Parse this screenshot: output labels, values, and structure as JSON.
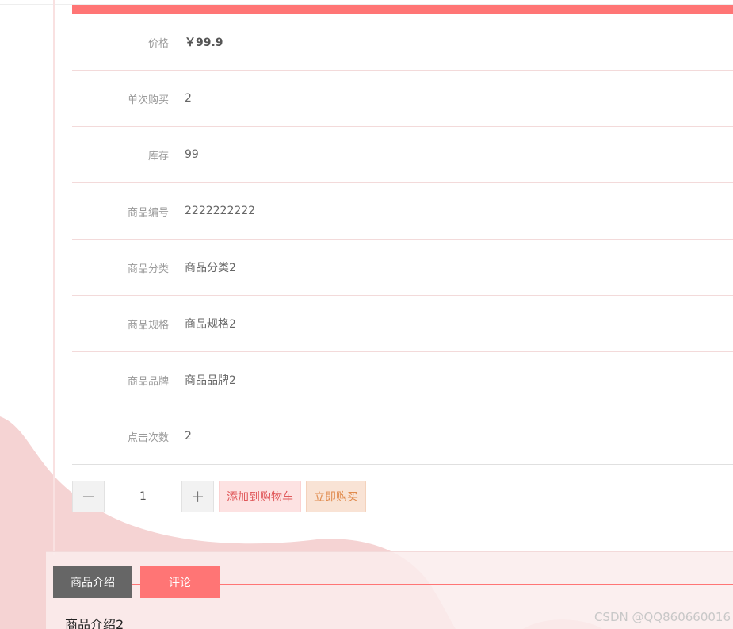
{
  "product_info": {
    "rows": [
      {
        "label": "价格",
        "value": "￥99.9"
      },
      {
        "label": "单次购买",
        "value": "2"
      },
      {
        "label": "库存",
        "value": "99"
      },
      {
        "label": "商品编号",
        "value": "2222222222"
      },
      {
        "label": "商品分类",
        "value": "商品分类2"
      },
      {
        "label": "商品规格",
        "value": "商品规格2"
      },
      {
        "label": "商品品牌",
        "value": "商品品牌2"
      },
      {
        "label": "点击次数",
        "value": "2"
      }
    ]
  },
  "purchase": {
    "minus_symbol": "－",
    "plus_symbol": "＋",
    "quantity": "1",
    "add_to_cart_label": "添加到购物车",
    "buy_now_label": "立即购买"
  },
  "detail": {
    "tabs": [
      {
        "label": "商品介绍"
      },
      {
        "label": "评论"
      }
    ],
    "intro_text": "商品介绍2"
  },
  "watermark": "CSDN @QQ860660016",
  "colors": {
    "accent": "#ff7575",
    "background_wave": "#f5d3d3",
    "tab_active": "#666666"
  }
}
